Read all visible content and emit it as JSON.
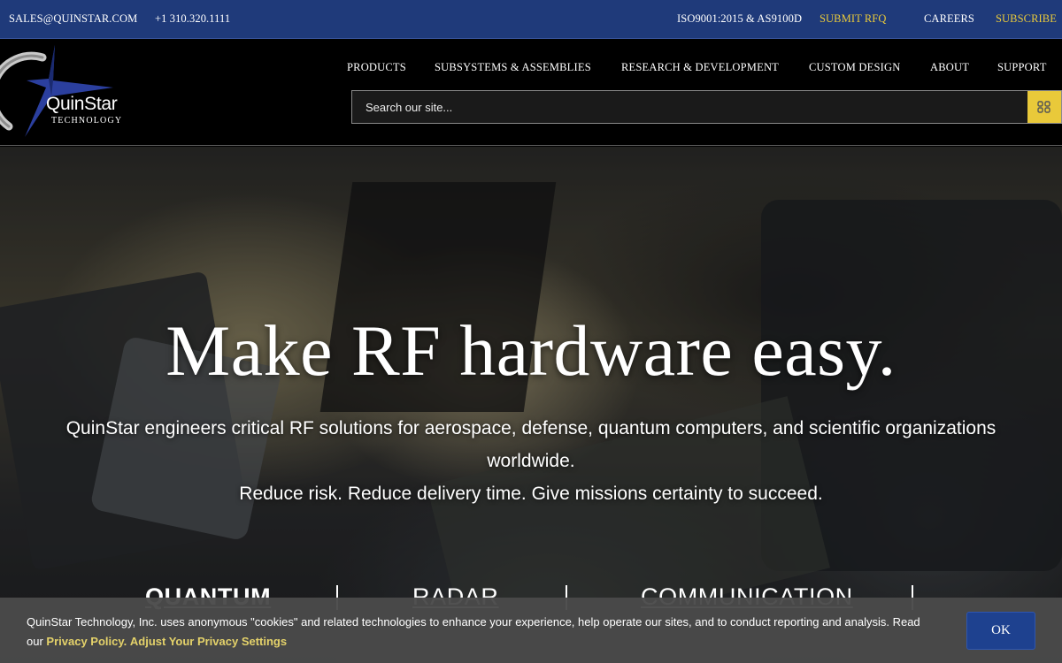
{
  "topbar": {
    "email": "SALES@QUINSTAR.COM",
    "phone": "+1 310.320.1111",
    "certification": "ISO9001:2015 & AS9100D",
    "submit_rfq": "SUBMIT RFQ",
    "careers": "CAREERS",
    "subscribe": "SUBSCRIBE",
    "accent_color": "#e9c93a",
    "bar_color": "#1f3a7a"
  },
  "logo": {
    "brand": "QUINSTAR",
    "brand_display": "QuinStar",
    "sub": "TECHNOLOGY",
    "icon": "star-compass-logo"
  },
  "nav": {
    "items": [
      "PRODUCTS",
      "SUBSYSTEMS & ASSEMBLIES",
      "RESEARCH & DEVELOPMENT",
      "CUSTOM DESIGN",
      "ABOUT",
      "SUPPORT"
    ]
  },
  "search": {
    "placeholder": "Search our site...",
    "value": "",
    "icon": "search-grid-icon"
  },
  "hero": {
    "headline": "Make RF hardware easy.",
    "lede": "QuinStar engineers critical RF solutions for aerospace, defense, quantum computers, and scientific organizations worldwide.",
    "lede2": "Reduce risk. Reduce delivery time. Give missions certainty to succeed.",
    "categories": [
      "QUANTUM",
      "RADAR",
      "COMMUNICATION"
    ]
  },
  "cookie": {
    "message": "QuinStar Technology, Inc. uses anonymous \"cookies\" and related technologies to enhance your experience, help operate our sites, and to conduct reporting and analysis. Read our",
    "privacy_link": "Privacy Policy.",
    "settings_link": "Adjust Your Privacy Settings",
    "ok_label": "OK",
    "link_color": "#e4d26a",
    "button_color": "#1e418f"
  }
}
